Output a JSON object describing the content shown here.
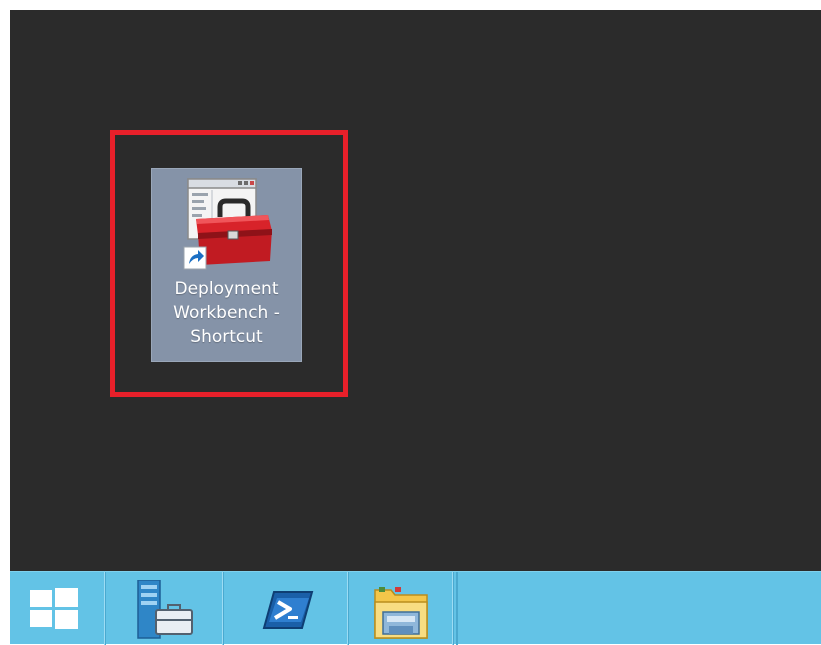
{
  "desktop": {
    "background": "#2b2b2b",
    "highlight_color": "#e8202a",
    "icons": [
      {
        "label_lines": [
          "Deployment",
          "Workbench -",
          "Shortcut"
        ],
        "icon": "toolbox-shortcut-icon",
        "selected": true
      }
    ]
  },
  "taskbar": {
    "background": "#63c3e6",
    "buttons": [
      {
        "icon": "windows-start-icon"
      },
      {
        "icon": "server-manager-icon"
      },
      {
        "icon": "powershell-icon"
      },
      {
        "icon": "file-explorer-icon"
      }
    ]
  }
}
